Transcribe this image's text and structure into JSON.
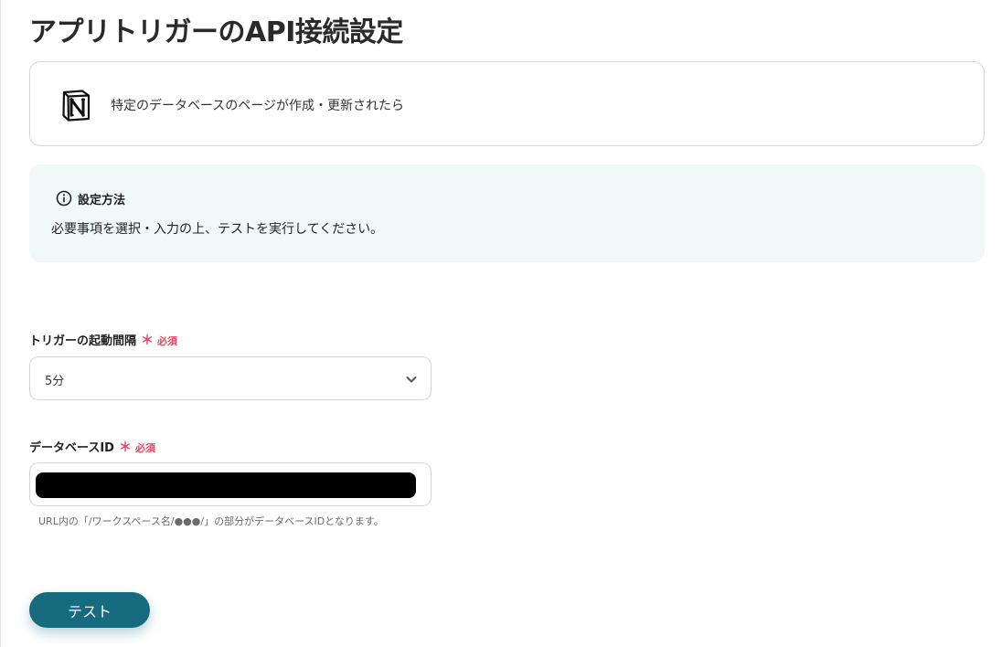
{
  "page": {
    "title": "アプリトリガーのAPI接続設定"
  },
  "app_card": {
    "logo_icon": "notion-logo-icon",
    "trigger_label": "特定のデータベースのページが作成・更新されたら"
  },
  "info_box": {
    "icon": "info-circle-icon",
    "heading": "設定方法",
    "body": "必要事項を選択・入力の上、テストを実行してください。"
  },
  "fields": {
    "interval": {
      "label": "トリガーの起動間隔",
      "required_mark": "＊",
      "required_text": "必須",
      "value": "5分",
      "icon": "chevron-down-icon"
    },
    "database_id": {
      "label": "データベースID",
      "required_mark": "＊",
      "required_text": "必須",
      "value": "",
      "help": "URL内の「/ワークスペース名/●●●/」の部分がデータベースIDとなります。"
    }
  },
  "actions": {
    "test_label": "テスト"
  },
  "colors": {
    "accent": "#176b7f",
    "required": "#e5475f",
    "info_bg": "#f1f8f8",
    "border": "#d6d6d6"
  }
}
